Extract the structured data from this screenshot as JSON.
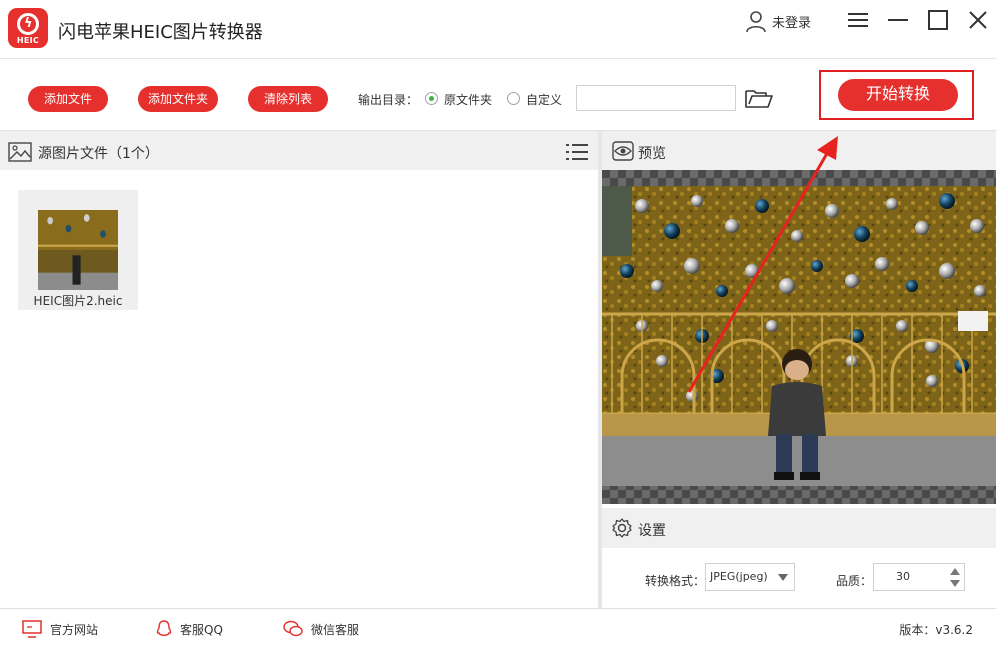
{
  "app": {
    "title": "闪电苹果HEIC图片转换器",
    "logo_text": "HEIC"
  },
  "user": {
    "login_label": "未登录"
  },
  "toolbar": {
    "add_file": "添加文件",
    "add_folder": "添加文件夹",
    "clear_list": "清除列表",
    "output_dir_label": "输出目录：",
    "option_original": "原文件夹",
    "option_custom": "自定义",
    "path_value": "",
    "start_convert": "开始转换"
  },
  "left_panel": {
    "title": "源图片文件（1个）",
    "files": [
      {
        "name": "HEIC图片2.heic"
      }
    ]
  },
  "preview": {
    "title": "预览"
  },
  "settings": {
    "title": "设置",
    "format_label": "转换格式：",
    "format_value": "JPEG(jpeg)",
    "quality_label": "品质：",
    "quality_value": "30"
  },
  "footer": {
    "website": "官方网站",
    "qq": "客服QQ",
    "wechat": "微信客服",
    "version": "版本：v3.6.2"
  },
  "colors": {
    "brand_red": "#e5302d",
    "highlight_red": "#e02020",
    "radio_green": "#3cb43c"
  }
}
